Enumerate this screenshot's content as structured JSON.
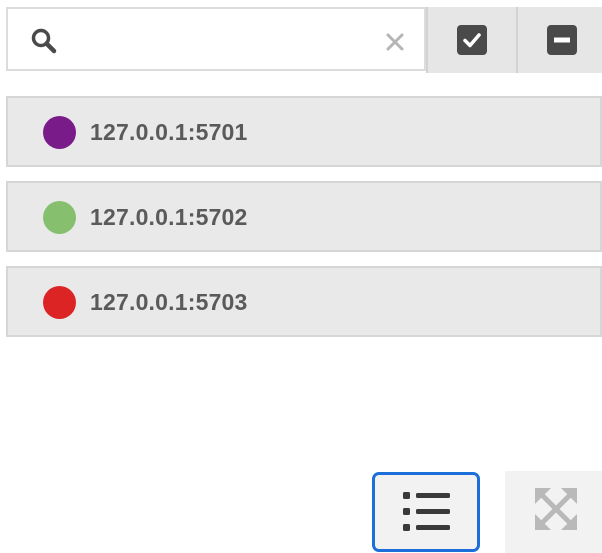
{
  "search": {
    "value": "",
    "placeholder": ""
  },
  "toolbar": {
    "select_all_icon": "checkbox-checked-icon",
    "deselect_all_icon": "minus-square-icon"
  },
  "members": [
    {
      "label": "127.0.0.1:5701",
      "color": "#7a1b8a"
    },
    {
      "label": "127.0.0.1:5702",
      "color": "#86bf6e"
    },
    {
      "label": "127.0.0.1:5703",
      "color": "#dc2424"
    }
  ],
  "views": {
    "list_view_icon": "list-icon",
    "graph_view_icon": "expand-arrows-icon",
    "active": "list"
  },
  "colors": {
    "accent": "#1c6fd8",
    "row_background": "#e9e9e9",
    "text": "#5a5a5a"
  }
}
